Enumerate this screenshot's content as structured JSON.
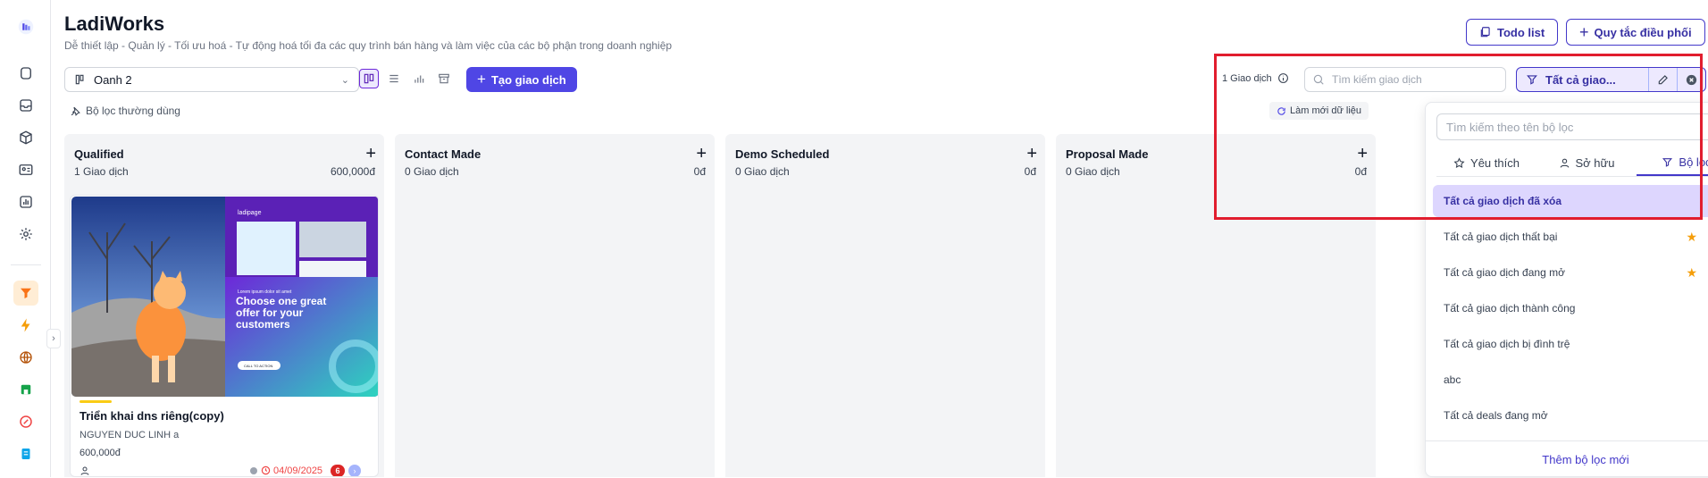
{
  "app": {
    "title": "LadiWorks",
    "subtitle": "Dễ thiết lập - Quản lý - Tối ưu hoá - Tự động hoá tối đa các quy trình bán hàng và làm việc của các bộ phận trong doanh nghiệp"
  },
  "header_buttons": {
    "todo": "Todo list",
    "rules": "Quy tắc điều phối"
  },
  "toolbar": {
    "pipeline_value": "Oanh 2",
    "create_label": "Tạo giao dịch",
    "saved_filters": "Bộ lọc thường dùng",
    "refresh": "Làm mới dữ liệu",
    "deal_count": "1 Giao dịch",
    "search_placeholder": "Tìm kiếm giao dịch",
    "filter_value": "Tất cả giao..."
  },
  "columns": [
    {
      "title": "Qualified",
      "count": "1 Giao dịch",
      "amount": "600,000đ"
    },
    {
      "title": "Contact Made",
      "count": "0 Giao dịch",
      "amount": "0đ"
    },
    {
      "title": "Demo Scheduled",
      "count": "0 Giao dịch",
      "amount": "0đ"
    },
    {
      "title": "Proposal Made",
      "count": "0 Giao dịch",
      "amount": "0đ"
    }
  ],
  "card": {
    "title": "Triển khai dns riêng(copy)",
    "owner": "NGUYEN DUC LINH a",
    "value": "600,000đ",
    "date": "04/09/2025",
    "badge": "6",
    "image": {
      "brand": "ladipage",
      "eyebrow": "Lorem ipsum dolor sit amet",
      "headline": "Choose one great offer for your customers",
      "cta": "CALL TO ACTION"
    }
  },
  "dropdown": {
    "search_placeholder": "Tìm kiếm theo tên bộ lọc",
    "tabs": [
      "Yêu thích",
      "Sở hữu",
      "Bộ lọc"
    ],
    "items": [
      "Tất cả giao dịch đã xóa",
      "Tất cả giao dịch thất bại",
      "Tất cả giao dịch đang mở",
      "Tất cả giao dịch thành công",
      "Tất cả giao dịch bị đình trệ",
      "abc",
      "Tất cả deals đang mở"
    ],
    "footer": "Thêm bộ lọc mới"
  },
  "colors": {
    "accent": "#4f46e5",
    "highlight": "#e11d2e",
    "star": "#f59e0b"
  }
}
